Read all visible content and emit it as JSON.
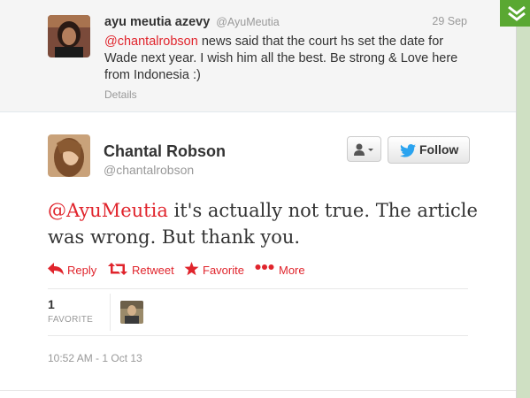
{
  "reply_context": {
    "name": "ayu meutia azevy",
    "handle": "@AyuMeutia",
    "date": "29 Sep",
    "mention": "@chantalrobson",
    "text": " news said that the court hs set the date for Wade next year. I wish him all the best. Be strong & Love here from Indonesia :)",
    "details_label": "Details"
  },
  "tweet": {
    "name": "Chantal Robson",
    "handle": "@chantalrobson",
    "mention": "@AyuMeutia",
    "text": " it's actually not true. The article was wrong. But thank you.",
    "timestamp": "10:52 AM - 1 Oct 13"
  },
  "follow_label": "Follow",
  "actions": {
    "reply": "Reply",
    "retweet": "Retweet",
    "favorite": "Favorite",
    "more": "More"
  },
  "stats": {
    "favorite_count": "1",
    "favorite_label": "FAVORITE"
  },
  "colors": {
    "accent_red": "#e0242c",
    "twitter_blue": "#2aa3ef",
    "corner_green": "#5aa832"
  },
  "icons": {
    "corner": "chevrons-down-icon",
    "user_dropdown": "user-icon",
    "follow": "twitter-bird-icon",
    "reply": "reply-arrow-icon",
    "retweet": "retweet-icon",
    "favorite": "star-icon",
    "more": "dots-icon"
  }
}
